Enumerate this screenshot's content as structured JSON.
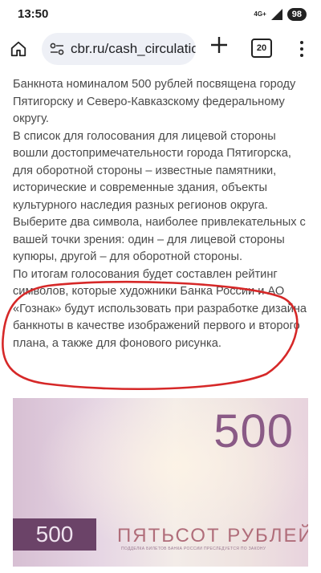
{
  "status_bar": {
    "time": "13:50",
    "network": "4G+",
    "battery": "98"
  },
  "browser": {
    "url": "cbr.ru/cash_circulatio",
    "tab_count": "20"
  },
  "article": {
    "paragraphs": [
      "Банкнота номиналом 500 рублей посвящена городу Пятигорску и Северо-Кавказскому федеральному округу.",
      "В список для голосования для лицевой стороны вошли достопримечательности города Пятигорска, для оборотной стороны – известные памятники, исторические и современные здания, объекты культурного наследия разных регионов округа. Выберите два символа, наиболее привлекательных с вашей точки зрения: один – для лицевой стороны купюры, другой – для оборотной стороны.",
      "По итогам голосования будет составлен рейтинг символов, которые художники Банка России и АО «Гознак» будут использовать при разработке дизайна банкноты в качестве изображений первого и второго плана, а также для фонового рисунка."
    ]
  },
  "banknote": {
    "denomination": "500",
    "small_denomination": "500",
    "words": "ПЯТЬСОТ РУБЛЕЙ",
    "warning": "ПОДДЕЛКА БИЛЕТОВ БАНКА РОССИИ ПРЕСЛЕДУЕТСЯ ПО ЗАКОНУ"
  },
  "colors": {
    "annotation": "#d62828",
    "note_accent": "#6b4368"
  }
}
